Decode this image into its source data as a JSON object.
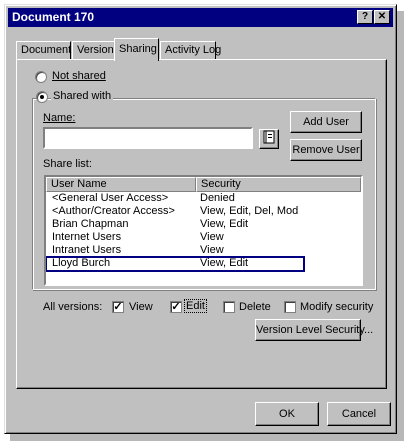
{
  "window": {
    "title": "Document 170",
    "help_glyph": "?",
    "close_glyph": "✕"
  },
  "tabs": [
    "Document",
    "Version",
    "Sharing",
    "Activity Log"
  ],
  "sharing": {
    "not_shared_label": "Not shared",
    "shared_with_label": "Shared with",
    "selected_option": "Shared with",
    "name_label": "Name:",
    "name_value": "",
    "add_user_label": "Add User",
    "remove_user_label": "Remove User",
    "share_list_label": "Share list:",
    "columns": [
      "User Name",
      "Security"
    ],
    "rows": [
      {
        "name": "<General User Access>",
        "security": "Denied"
      },
      {
        "name": "<Author/Creator Access>",
        "security": "View, Edit, Del, Mod"
      },
      {
        "name": "Brian Chapman",
        "security": "View, Edit"
      },
      {
        "name": "Internet Users",
        "security": "View"
      },
      {
        "name": "Intranet Users",
        "security": "View"
      },
      {
        "name": "Lloyd Burch",
        "security": "View, Edit"
      }
    ],
    "focused_row": "Lloyd Burch",
    "all_versions_label": "All versions:",
    "checkboxes": {
      "view": {
        "label": "View",
        "checked": true
      },
      "edit": {
        "label": "Edit",
        "checked": true
      },
      "delete": {
        "label": "Delete",
        "checked": false
      },
      "modify_security": {
        "label": "Modify security",
        "checked": false
      }
    },
    "version_level_security_label": "Version Level Security..."
  },
  "footer": {
    "ok_label": "OK",
    "cancel_label": "Cancel"
  },
  "icons": {
    "address_book": "book-icon"
  }
}
